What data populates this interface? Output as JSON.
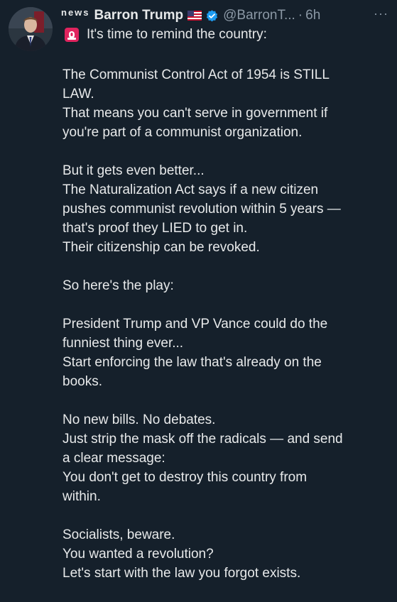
{
  "author": {
    "news_tag": "news",
    "name": "Barron Trump",
    "handle": "@BarronT...",
    "separator": "·",
    "time": "6h",
    "flag_icon": "us-flag-icon",
    "verified_icon": "verified-badge-icon",
    "more_label": "···"
  },
  "tweet": {
    "first_line": "It's time to remind the country:",
    "paragraphs": [
      [
        "The Communist Control Act of 1954 is STILL",
        "LAW.",
        "That means you can't serve in government if",
        "you're part of a communist organization."
      ],
      [
        "But it gets even better...",
        "The Naturalization Act says if a new citizen",
        "pushes communist revolution within 5 years —",
        "that's proof they LIED to get in.",
        "Their citizenship can be revoked."
      ],
      [
        "So here's the play:"
      ],
      [
        "President Trump and VP Vance could do the",
        "funniest thing ever...",
        "Start enforcing the law that's already on the",
        "books."
      ],
      [
        "No new bills. No debates.",
        "Just strip the mask off the radicals — and send",
        "a clear message:",
        "You don't get to destroy this country from",
        "within."
      ],
      [
        "Socialists, beware.",
        "You wanted a revolution?",
        "Let's start with the law you forgot exists."
      ]
    ]
  },
  "colors": {
    "background": "#15202b",
    "text": "#e7e9ea",
    "muted": "#8b98a5",
    "verified": "#1d9bf0",
    "siren": "#e0245e"
  }
}
